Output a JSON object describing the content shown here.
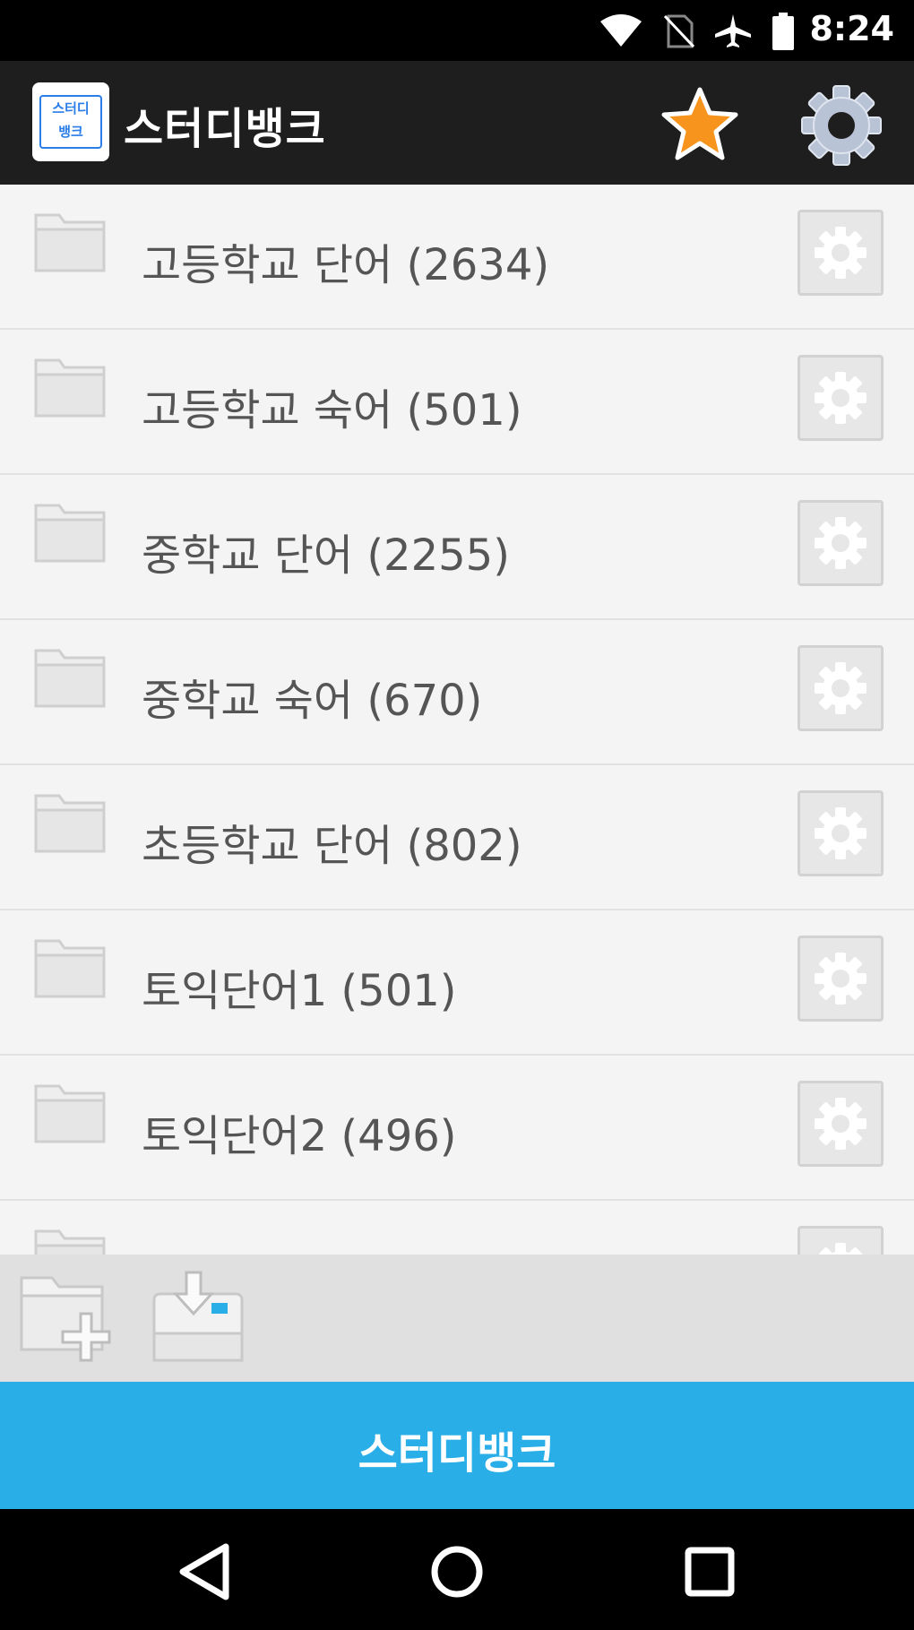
{
  "status_bar": {
    "time": "8:24",
    "icons": [
      "wifi-icon",
      "no-sim-icon",
      "airplane-icon",
      "battery-icon"
    ]
  },
  "app_bar": {
    "logo_text_line1": "스터디",
    "logo_text_line2": "뱅크",
    "title": "스터디뱅크",
    "favorite_icon": "star-icon",
    "settings_icon": "gear-icon"
  },
  "list": {
    "items": [
      {
        "label": "고등학교 단어 (2634)"
      },
      {
        "label": "고등학교 숙어 (501)"
      },
      {
        "label": "중학교 단어 (2255)"
      },
      {
        "label": "중학교 숙어 (670)"
      },
      {
        "label": "초등학교 단어 (802)"
      },
      {
        "label": "토익단어1 (501)"
      },
      {
        "label": "토익단어2 (496)"
      },
      {
        "label": ""
      }
    ]
  },
  "toolbar": {
    "add_folder_icon": "add-folder-icon",
    "download_icon": "download-icon"
  },
  "banner": {
    "label": "스터디뱅크"
  },
  "colors": {
    "accent": "#29aee8",
    "star": "#f7941d",
    "app_bar": "#1e1e1e"
  }
}
